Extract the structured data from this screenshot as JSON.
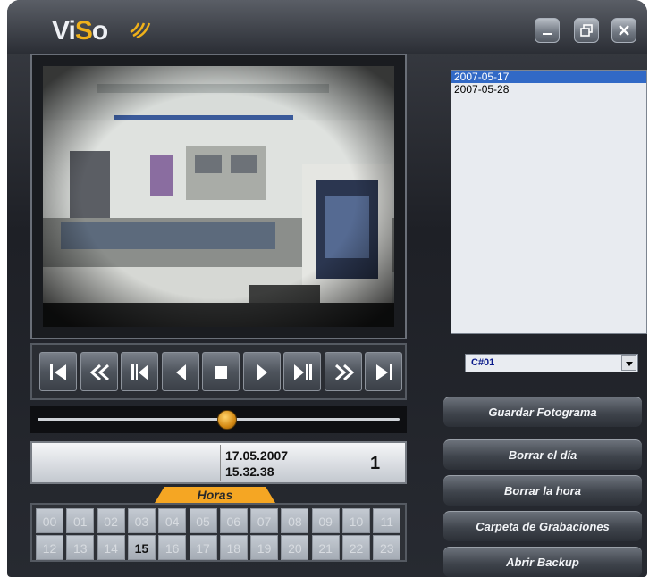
{
  "app": {
    "logo_text": "ViSo"
  },
  "window_controls": [
    "minimize",
    "restore",
    "close"
  ],
  "dates": [
    {
      "label": "2007-05-17",
      "selected": true
    },
    {
      "label": "2007-05-28",
      "selected": false
    }
  ],
  "camera_select": {
    "value": "C#01"
  },
  "buttons": {
    "save_frame": "Guardar Fotograma",
    "delete_day": "Borrar el día",
    "delete_hour": "Borrar la hora",
    "recordings_folder": "Carpeta de Grabaciones",
    "open_backup": "Abrir Backup"
  },
  "playback": {
    "controls": [
      "go-first-icon",
      "rewind-icon",
      "step-back-icon",
      "play-reverse-icon",
      "stop-icon",
      "play-icon",
      "step-forward-icon",
      "fast-forward-icon",
      "go-last-icon"
    ],
    "position": 0.52
  },
  "info": {
    "date": "17.05.2007",
    "time": "15.32.38",
    "camera_number": "1"
  },
  "hours": {
    "tab_label": "Horas",
    "cells": [
      "00",
      "01",
      "02",
      "03",
      "04",
      "05",
      "06",
      "07",
      "08",
      "09",
      "10",
      "11",
      "12",
      "13",
      "14",
      "15",
      "16",
      "17",
      "18",
      "19",
      "20",
      "21",
      "22",
      "23"
    ],
    "active": "15"
  },
  "colors": {
    "accent_orange": "#f5a623",
    "selection_blue": "#3169c6",
    "camera_text": "#0a1a8a"
  }
}
